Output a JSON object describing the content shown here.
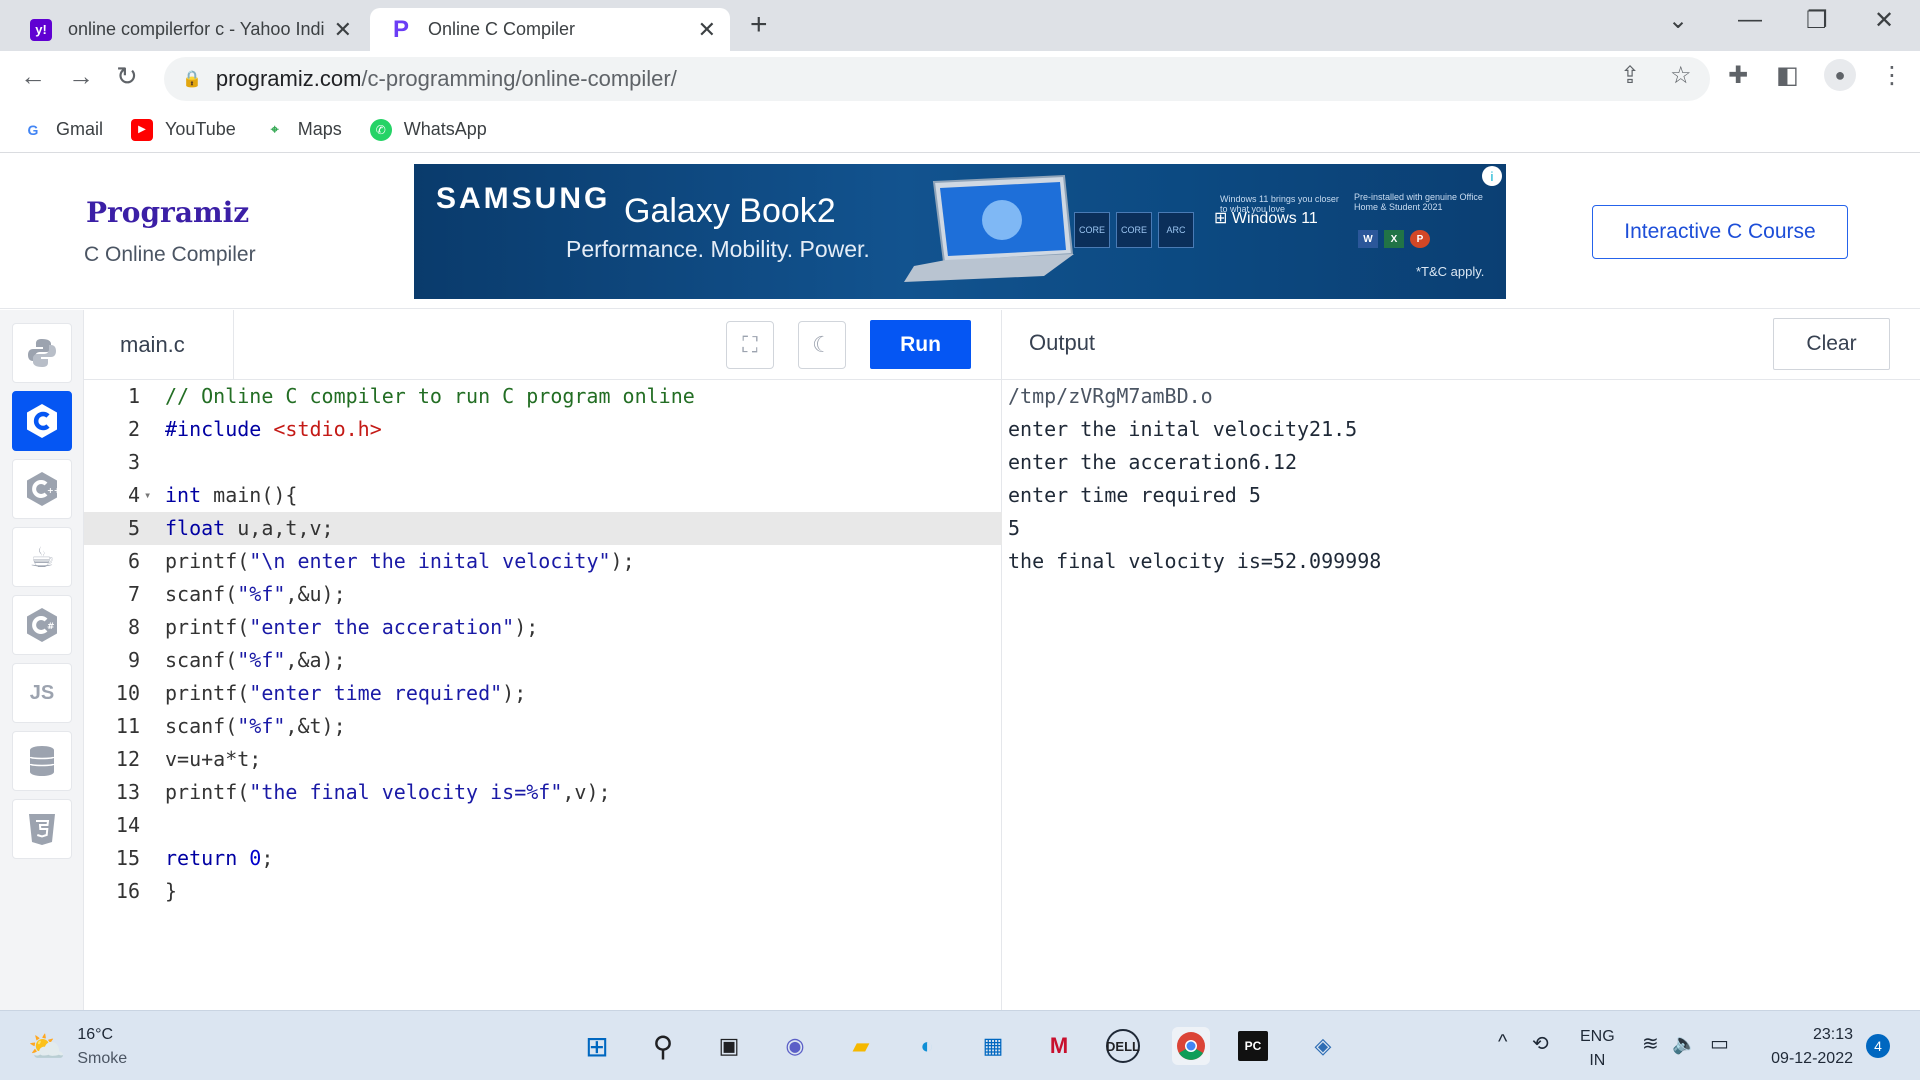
{
  "browser": {
    "tabs": [
      {
        "title": "online compilerfor c - Yahoo Indi",
        "favicon": "yahoo-icon"
      },
      {
        "title": "Online C Compiler",
        "favicon": "programiz-icon"
      }
    ],
    "url_host": "programiz.com",
    "url_path": "/c-programming/online-compiler/",
    "bookmarks": [
      {
        "label": "Gmail",
        "icon": "google-icon"
      },
      {
        "label": "YouTube",
        "icon": "youtube-icon"
      },
      {
        "label": "Maps",
        "icon": "maps-icon"
      },
      {
        "label": "WhatsApp",
        "icon": "whatsapp-icon"
      }
    ]
  },
  "site": {
    "logo": "Programiz",
    "subtitle": "C Online Compiler",
    "course_button": "Interactive C Course",
    "ad": {
      "brand": "SAMSUNG",
      "model": "Galaxy Book2",
      "tagline": "Performance. Mobility. Power.",
      "win_small": "Windows 11 brings you closer to what you love",
      "win_label": "Windows 11",
      "office_small": "Pre-installed with genuine Office Home & Student 2021",
      "tnc": "*T&C apply.",
      "chips": [
        "CORE",
        "CORE",
        "ARC"
      ]
    }
  },
  "languages": [
    "python-icon",
    "c-icon",
    "cpp-icon",
    "java-icon",
    "csharp-icon",
    "js-icon",
    "sql-icon",
    "html-icon"
  ],
  "languages_js_label": "JS",
  "editor": {
    "filename": "main.c",
    "run_label": "Run",
    "current_line": 5,
    "lines": [
      "// Online C compiler to run C program online",
      "#include <stdio.h>",
      "",
      "int main(){",
      "float u,a,t,v;",
      "printf(\"\\n enter the inital velocity\");",
      "scanf(\"%f\",&u);",
      "printf(\"enter the acceration\");",
      "scanf(\"%f\",&a);",
      "printf(\"enter time required\");",
      "scanf(\"%f\",&t);",
      "v=u+a*t;",
      "printf(\"the final velocity is=%f\",v);",
      "",
      "return 0;",
      "}"
    ]
  },
  "output": {
    "title": "Output",
    "clear_label": "Clear",
    "lines": [
      "/tmp/zVRgM7amBD.o",
      "enter the inital velocity21.5",
      "enter the acceration6.12",
      "enter time required 5",
      "5",
      "the final velocity is=52.099998"
    ]
  },
  "taskbar": {
    "temperature": "16°C",
    "weather": "Smoke",
    "language": "ENG",
    "region": "IN",
    "time": "23:13",
    "date": "09-12-2022",
    "notifications": "4"
  },
  "colors": {
    "accent": "#0556f3",
    "chrome_bg": "#dee1e6",
    "taskbar_bg": "#dbe5f1"
  }
}
